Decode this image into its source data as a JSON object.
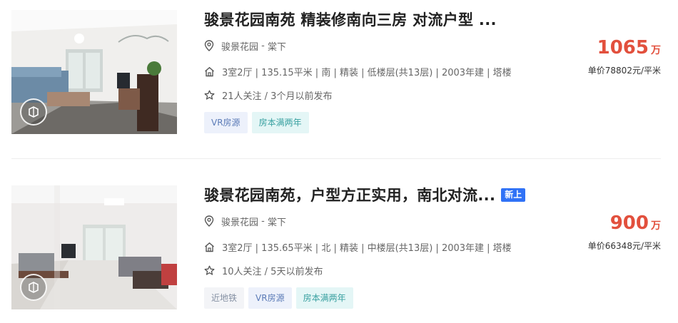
{
  "listings": [
    {
      "title": "骏景花园南苑 精装修南向三房 对流户型 ...",
      "new_tag": "",
      "community": "骏景花园",
      "area": "棠下",
      "location_sep": " - ",
      "details": "3室2厅 | 135.15平米 | 南 | 精装 | 低楼层(共13层) | 2003年建 | 塔楼",
      "followers": "21人关注 / 3个月以前发布",
      "tags": [
        "VR房源",
        "房本满两年"
      ],
      "total_price": "1065",
      "total_unit": "万",
      "unit_price": "单价78802元/平米"
    },
    {
      "title": "骏景花园南苑，户型方正实用，南北对流...",
      "new_tag": "新上",
      "community": "骏景花园",
      "area": "棠下",
      "location_sep": " - ",
      "details": "3室2厅 | 135.65平米 | 北 | 精装 | 中楼层(共13层) | 2003年建 | 塔楼",
      "followers": "10人关注 / 5天以前发布",
      "tags": [
        "近地铁",
        "VR房源",
        "房本满两年"
      ],
      "total_price": "900",
      "total_unit": "万",
      "unit_price": "单价66348元/平米"
    }
  ],
  "icons": {
    "location": "map-pin-icon",
    "house": "house-icon",
    "follow": "star-icon",
    "vr": "vr-badge-icon"
  },
  "colors": {
    "price": "#e2503d",
    "new_tag_bg": "#3072f6",
    "vr_tag_bg": "#edf1fb",
    "two_year_tag_bg": "#e4f6f6",
    "metro_tag_bg": "#f3f4f7"
  }
}
